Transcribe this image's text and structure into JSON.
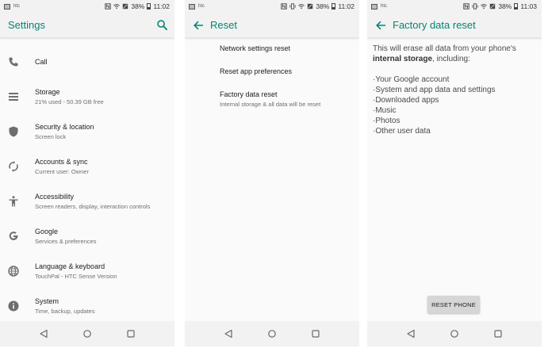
{
  "colors": {
    "accent": "#008577",
    "bar_bg": "#f2f2f2",
    "content_bg": "#fafafa",
    "text_primary": "#212121",
    "text_secondary": "#6f6f6f"
  },
  "status_bar": {
    "carrier": "htc",
    "panel1_battery": "38%",
    "panel1_time": "11:02",
    "panel2_battery": "38%",
    "panel2_time": "11:02",
    "panel3_battery": "38%",
    "panel3_time": "11:03",
    "icons": [
      "image-icon",
      "nfc-icon",
      "wifi-icon",
      "no-sim-icon",
      "battery-icon"
    ]
  },
  "settings": {
    "title": "Settings",
    "items": [
      {
        "title": "Call",
        "subtitle": "",
        "icon": "phone-icon"
      },
      {
        "title": "Storage",
        "subtitle": "21% used - 50.39 GB free",
        "icon": "storage-icon"
      },
      {
        "title": "Security & location",
        "subtitle": "Screen lock",
        "icon": "shield-icon"
      },
      {
        "title": "Accounts & sync",
        "subtitle": "Current user: Owner",
        "icon": "sync-icon"
      },
      {
        "title": "Accessibility",
        "subtitle": "Screen readers, display, interaction controls",
        "icon": "accessibility-icon"
      },
      {
        "title": "Google",
        "subtitle": "Services & preferences",
        "icon": "google-icon"
      },
      {
        "title": "Language & keyboard",
        "subtitle": "TouchPal - HTC Sense Version",
        "icon": "globe-icon"
      },
      {
        "title": "System",
        "subtitle": "Time, backup, updates",
        "icon": "info-icon"
      }
    ]
  },
  "reset": {
    "title": "Reset",
    "items": [
      {
        "title": "Network settings reset",
        "subtitle": ""
      },
      {
        "title": "Reset app preferences",
        "subtitle": ""
      },
      {
        "title": "Factory data reset",
        "subtitle": "Internal storage & all data will be reset"
      }
    ]
  },
  "factory_reset": {
    "title": "Factory data reset",
    "intro_before": "This will erase all data from your phone's ",
    "intro_bold": "internal storage",
    "intro_after": ", including:",
    "list": [
      "·Your Google account",
      "·System and app data and settings",
      "·Downloaded apps",
      "·Music",
      "·Photos",
      "·Other user data"
    ],
    "button_label": "RESET PHONE"
  },
  "nav": {
    "buttons": [
      "back-nav-icon",
      "home-nav-icon",
      "recents-nav-icon"
    ]
  }
}
